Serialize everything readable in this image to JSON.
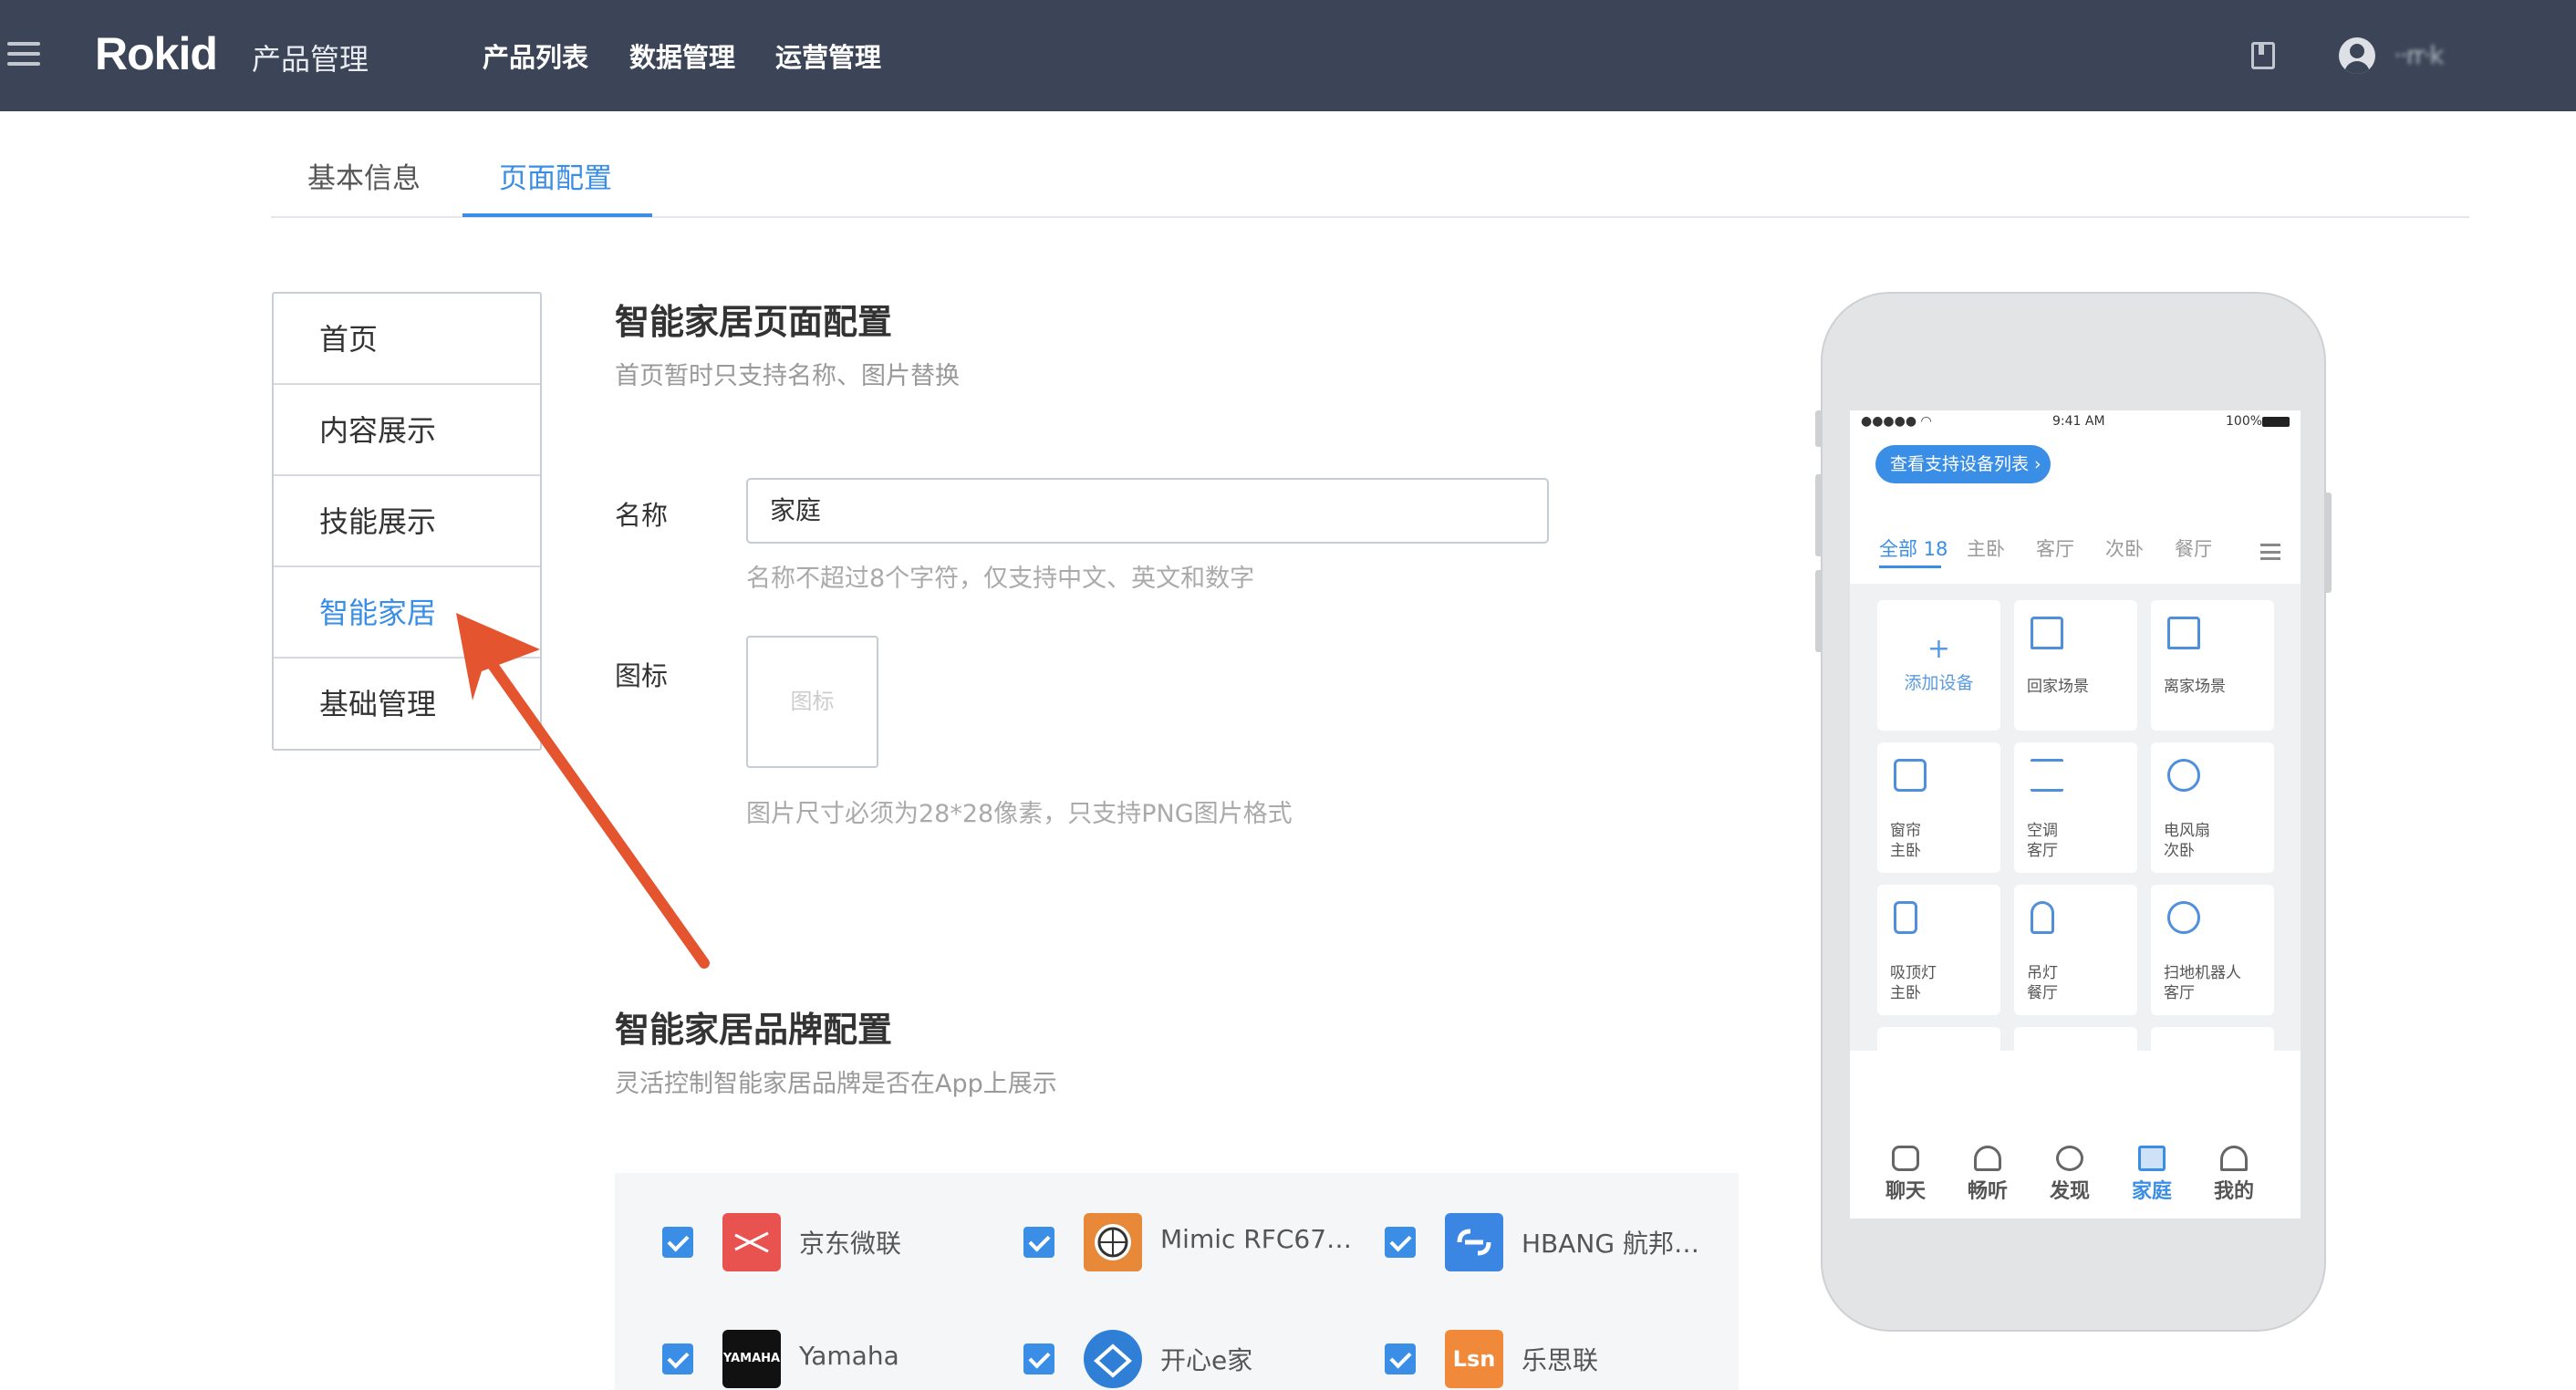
{
  "topbar": {
    "logo": "Rokid",
    "section": "产品管理",
    "nav": [
      "产品列表",
      "数据管理",
      "运营管理"
    ],
    "username": "··rr·k"
  },
  "tabs": [
    "基本信息",
    "页面配置"
  ],
  "active_tab": "页面配置",
  "sidemenu": [
    "首页",
    "内容展示",
    "技能展示",
    "智能家居",
    "基础管理"
  ],
  "active_menu": "智能家居",
  "page_config": {
    "title": "智能家居页面配置",
    "subtitle": "首页暂时只支持名称、图片替换",
    "name_label": "名称",
    "name_value": "家庭",
    "name_hint": "名称不超过8个字符，仅支持中文、英文和数字",
    "icon_label": "图标",
    "icon_placeholder": "图标",
    "icon_hint": "图片尺寸必须为28*28像素，只支持PNG图片格式"
  },
  "brand_config": {
    "title": "智能家居品牌配置",
    "subtitle": "灵活控制智能家居品牌是否在App上展示",
    "brands": [
      {
        "name": "京东微联",
        "checked": true,
        "logo_color": "#e8524f"
      },
      {
        "name": "Mimic RFC67…",
        "checked": true,
        "logo_color": "#e8893a"
      },
      {
        "name": "HBANG 航邦…",
        "checked": true,
        "logo_color": "#3b86e3"
      },
      {
        "name": "Yamaha",
        "checked": true,
        "logo_color": "#111111",
        "logo_text": "YAMAHA"
      },
      {
        "name": "开心e家",
        "checked": true,
        "logo_color": "#2f7fd6"
      },
      {
        "name": "乐思联",
        "checked": true,
        "logo_color": "#f08a3a",
        "logo_text": "Lsn"
      }
    ]
  },
  "phone": {
    "status_time": "9:41 AM",
    "status_battery": "100%",
    "device_list_button": "查看支持设备列表 ›",
    "room_tabs": [
      "全部 18",
      "主卧",
      "客厅",
      "次卧",
      "餐厅"
    ],
    "cards": [
      {
        "title": "添加设备",
        "room": ""
      },
      {
        "title": "回家场景",
        "room": ""
      },
      {
        "title": "离家场景",
        "room": ""
      },
      {
        "title": "窗帘",
        "room": "主卧"
      },
      {
        "title": "空调",
        "room": "客厅"
      },
      {
        "title": "电风扇",
        "room": "次卧"
      },
      {
        "title": "吸顶灯",
        "room": "主卧"
      },
      {
        "title": "吊灯",
        "room": "餐厅"
      },
      {
        "title": "扫地机器人",
        "room": "客厅"
      }
    ],
    "bottom_nav": [
      "聊天",
      "畅听",
      "发现",
      "家庭",
      "我的"
    ],
    "active_nav": "家庭"
  }
}
